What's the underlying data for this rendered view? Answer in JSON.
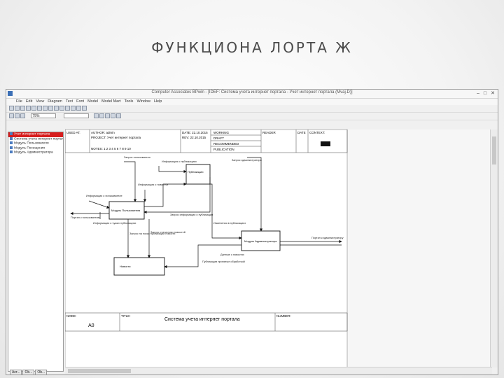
{
  "slide": {
    "title": "ФУНКЦИОНА   ЛОРТА  Ж"
  },
  "window": {
    "title": "Computer Associates BPwin - [IDEF: Система учета интернет портала - Учет интернет портала (Mvaj.D)]",
    "menu": [
      "File",
      "Edit",
      "View",
      "Diagram",
      "Text",
      "Font",
      "Model",
      "Model Mart",
      "Tools",
      "Window",
      "Help"
    ],
    "zoom_select": "75%",
    "font_select": ""
  },
  "sidebar": {
    "items": [
      {
        "label": "Учет интернет портала",
        "selected": true
      },
      {
        "label": "Система учета интернет портала",
        "selected": false
      },
      {
        "label": "Модуль Пользователя",
        "selected": false
      },
      {
        "label": "Модуль Посещения",
        "selected": false
      },
      {
        "label": "Модуль Администратора",
        "selected": false
      }
    ],
    "tabs": [
      "Акт...",
      "Ob...",
      "Ob..."
    ]
  },
  "diagram": {
    "header": {
      "used_at": "USED AT:",
      "author": "AUTHOR: admin",
      "project": "PROJECT: Учет интернет портала",
      "notes": "NOTES: 1 2 3 4 5 6 7 8 9 10",
      "date1": "DATE: 22.10.2015",
      "rev": "REV: 22.10.2015",
      "working": "WORKING",
      "draft": "DRAFT",
      "recommended": "RECOMMENDED",
      "publication": "PUBLICATION",
      "reader": "READER",
      "date_col": "DATE",
      "context": "CONTEXT:"
    },
    "footer": {
      "node_label": "NODE:",
      "node_value": "A0",
      "title_label": "TITLE:",
      "title_value": "Система учета интернет портала",
      "number_label": "NUMBER:"
    },
    "boxes": {
      "publications": "Публикации",
      "user_module": "Модуль Пользователя",
      "admin_module": "Модуль Администратора",
      "news": "Новости"
    },
    "arrows": {
      "user_request": "Запрос пользователя",
      "publication_info": "Информация о публикациях",
      "news_info": "Информация о новостях",
      "admin_request": "Запрос администратора",
      "user_info": "Информация о пользователе",
      "output_to_user": "Портал к пользователю",
      "info_to_publications": "Информация о чужих публикациях",
      "request_news_view": "Запрос на показ публикации новости",
      "news_view_request": "Запрос статистики новостей",
      "info_publication_request": "Запрос информации о публикации",
      "pub_changes": "Изменения в публикациях",
      "news_data": "Данные о новостях",
      "rejected_pubs": "Публикации принятые обработкой",
      "output_to_admin": "Портал к администратору"
    }
  }
}
